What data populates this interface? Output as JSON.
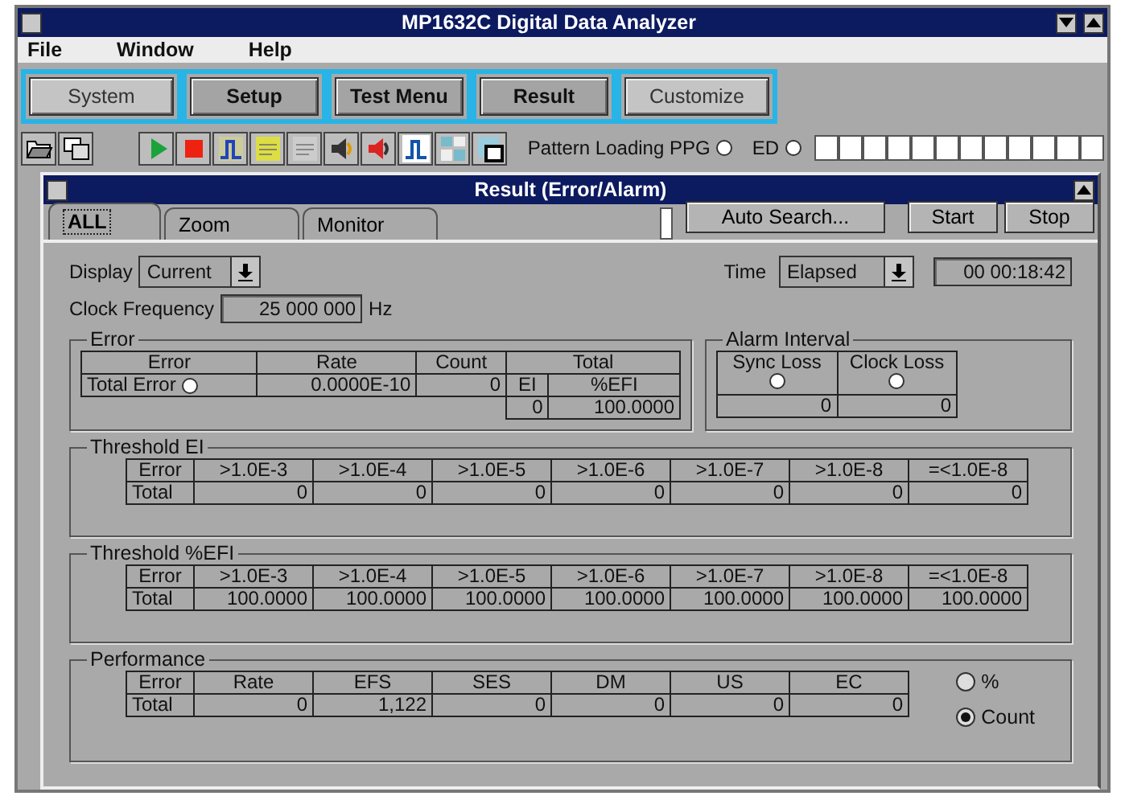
{
  "window": {
    "title": "MP1632C Digital Data Analyzer"
  },
  "menu": [
    "File",
    "Window",
    "Help"
  ],
  "nav_buttons": [
    {
      "label": "System",
      "kind": "plain"
    },
    {
      "label": "Setup",
      "kind": "bold"
    },
    {
      "label": "Test Menu",
      "kind": "bold"
    },
    {
      "label": "Result",
      "kind": "bold"
    },
    {
      "label": "Customize",
      "kind": "plain"
    }
  ],
  "status": {
    "label": "Pattern Loading PPG",
    "ppg_on": false,
    "ed_label": "ED",
    "ed_on": false
  },
  "subwindow": {
    "title": "Result (Error/Alarm)"
  },
  "tabs": [
    {
      "label": "ALL",
      "selected": true
    },
    {
      "label": "Zoom",
      "selected": false
    },
    {
      "label": "Monitor",
      "selected": false
    }
  ],
  "buttons": [
    "Auto Search...",
    "Start",
    "Stop"
  ],
  "display": {
    "label": "Display",
    "value": "Current"
  },
  "time": {
    "label": "Time",
    "value": "Elapsed",
    "reading": "00 00:18:42"
  },
  "clock": {
    "label": "Clock Frequency",
    "value": "25 000 000",
    "unit": "Hz"
  },
  "error": {
    "title": "Error",
    "columns": [
      "Error",
      "Rate",
      "Count"
    ],
    "total_heading": "Total",
    "sub_columns": [
      "EI",
      "%EFI"
    ],
    "row": {
      "label": "Total Error",
      "lamp_on": false,
      "rate": "0.0000E-10",
      "count": "0",
      "ei": "0",
      "efi": "100.0000"
    }
  },
  "alarm": {
    "title": "Alarm Interval",
    "columns": [
      {
        "label": "Sync Loss",
        "on": false,
        "value": "0"
      },
      {
        "label": "Clock Loss",
        "on": false,
        "value": "0"
      }
    ]
  },
  "threshold_ei": {
    "title": "Threshold EI",
    "columns": [
      "Error",
      ">1.0E-3",
      ">1.0E-4",
      ">1.0E-5",
      ">1.0E-6",
      ">1.0E-7",
      ">1.0E-8",
      "=<1.0E-8"
    ],
    "row": [
      "Total",
      "0",
      "0",
      "0",
      "0",
      "0",
      "0",
      "0"
    ]
  },
  "threshold_efi": {
    "title": "Threshold %EFI",
    "columns": [
      "Error",
      ">1.0E-3",
      ">1.0E-4",
      ">1.0E-5",
      ">1.0E-6",
      ">1.0E-7",
      ">1.0E-8",
      "=<1.0E-8"
    ],
    "row": [
      "Total",
      "100.0000",
      "100.0000",
      "100.0000",
      "100.0000",
      "100.0000",
      "100.0000",
      "100.0000"
    ]
  },
  "performance": {
    "title": "Performance",
    "columns": [
      "Error",
      "Rate",
      "EFS",
      "SES",
      "DM",
      "US",
      "EC"
    ],
    "row": [
      "Total",
      "0",
      "1,122",
      "0",
      "0",
      "0",
      "0"
    ],
    "options": [
      {
        "label": "%",
        "selected": false
      },
      {
        "label": "Count",
        "selected": true
      }
    ]
  }
}
